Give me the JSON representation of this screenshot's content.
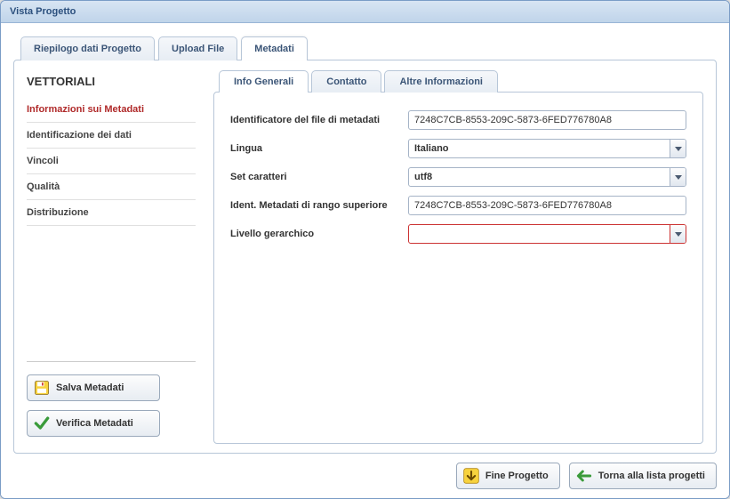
{
  "window": {
    "title": "Vista Progetto"
  },
  "topTabs": {
    "t0": "Riepilogo dati Progetto",
    "t1": "Upload File",
    "t2": "Metadati"
  },
  "sidebar": {
    "title": "VETTORIALI",
    "items": {
      "i0": "Informazioni sui Metadati",
      "i1": "Identificazione dei dati",
      "i2": "Vincoli",
      "i3": "Qualità",
      "i4": "Distribuzione"
    },
    "buttons": {
      "save": "Salva Metadati",
      "verify": "Verifica Metadati"
    }
  },
  "subTabs": {
    "s0": "Info Generali",
    "s1": "Contatto",
    "s2": "Altre Informazioni"
  },
  "form": {
    "fileIdLabel": "Identificatore del file di metadati",
    "fileIdValue": "7248C7CB-8553-209C-5873-6FED776780A8",
    "languageLabel": "Lingua",
    "languageValue": "Italiano",
    "charsetLabel": "Set caratteri",
    "charsetValue": "utf8",
    "parentIdLabel": "Ident. Metadati di rango superiore",
    "parentIdValue": "7248C7CB-8553-209C-5873-6FED776780A8",
    "hierarchyLabel": "Livello gerarchico",
    "hierarchyValue": ""
  },
  "footer": {
    "end": "Fine Progetto",
    "back": "Torna alla lista progetti"
  }
}
